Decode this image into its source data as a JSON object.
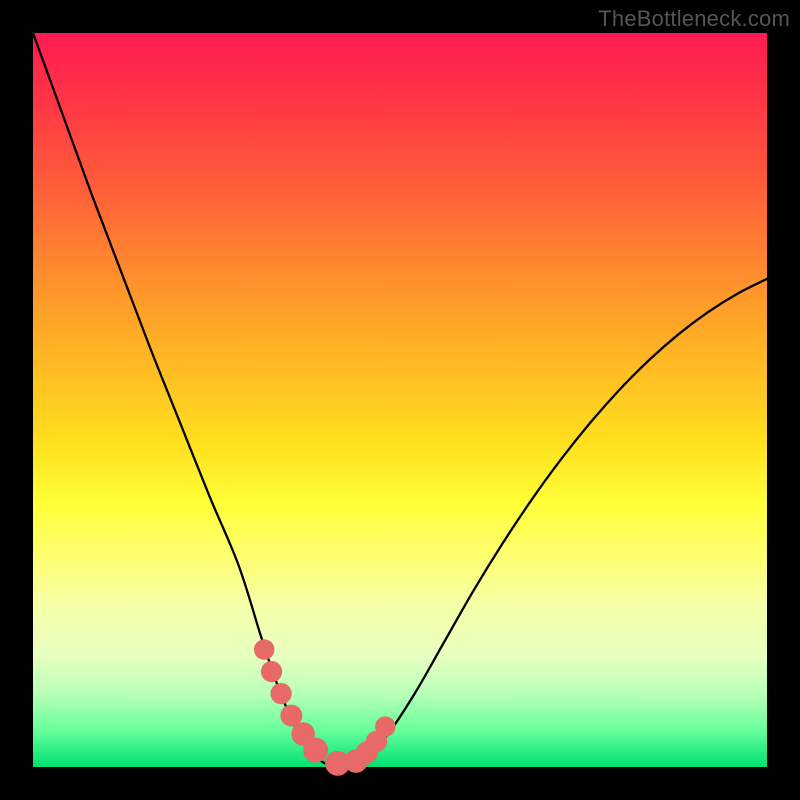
{
  "watermark": "TheBottleneck.com",
  "colors": {
    "background": "#000000",
    "curve": "#000000",
    "marker": "#e86a66",
    "gradient_top": "#ff1a52",
    "gradient_bottom": "#00e070"
  },
  "chart_data": {
    "type": "line",
    "title": "",
    "xlabel": "",
    "ylabel": "",
    "xlim": [
      0,
      100
    ],
    "ylim": [
      0,
      100
    ],
    "x": [
      0,
      4,
      8,
      12,
      16,
      20,
      24,
      28,
      31,
      33,
      35,
      37,
      39,
      41,
      43,
      45,
      48,
      52,
      56,
      60,
      64,
      68,
      72,
      76,
      80,
      84,
      88,
      92,
      96,
      100
    ],
    "series": [
      {
        "name": "bottleneck-curve",
        "values": [
          100,
          89,
          78,
          67.5,
          57,
          47,
          37,
          27.5,
          18,
          12,
          7,
          3,
          1,
          0,
          0,
          1,
          4,
          10,
          17,
          24,
          30.5,
          36.5,
          42,
          47,
          51.5,
          55.5,
          59,
          62,
          64.5,
          66.5
        ]
      }
    ],
    "markers": {
      "name": "highlight-region",
      "x": [
        31.5,
        32.5,
        33.8,
        35.2,
        36.8,
        38.5,
        41.5,
        44.0,
        45.5,
        46.8,
        48.0
      ],
      "y": [
        16,
        13,
        10,
        7,
        4.5,
        2.3,
        0.5,
        0.8,
        2.0,
        3.5,
        5.5
      ],
      "r": [
        1.4,
        1.45,
        1.45,
        1.5,
        1.6,
        1.7,
        1.7,
        1.6,
        1.5,
        1.45,
        1.4
      ]
    }
  }
}
